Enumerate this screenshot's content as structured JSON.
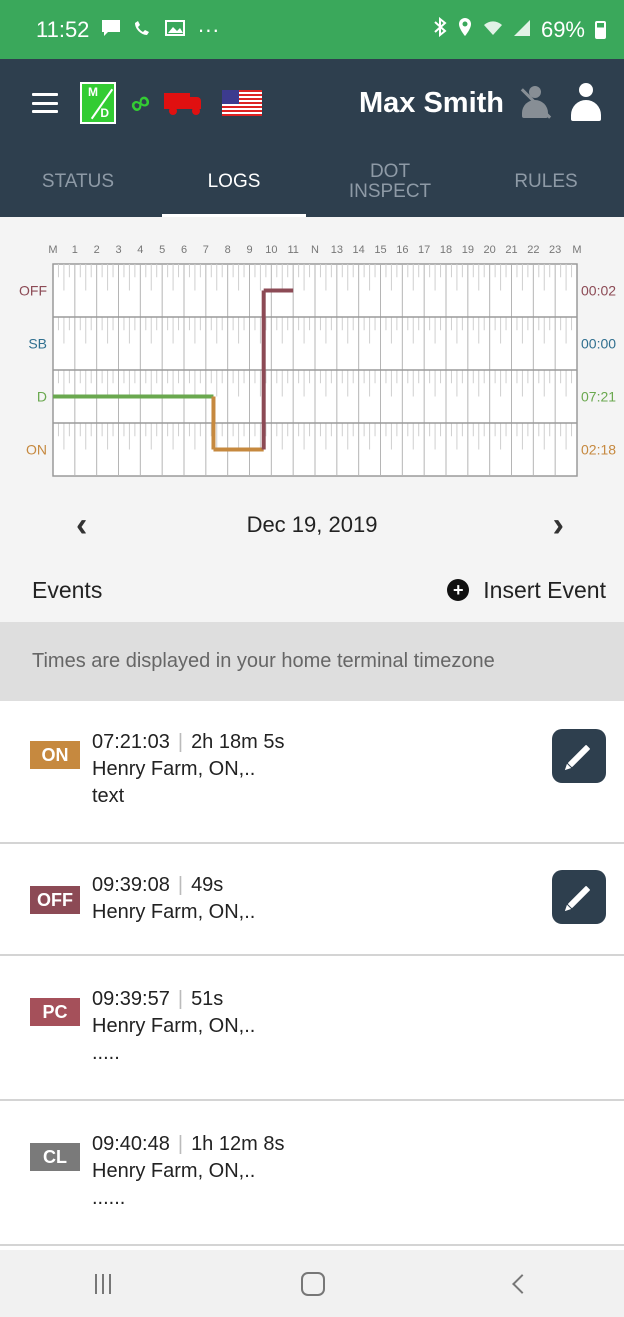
{
  "status_bar": {
    "time": "11:52",
    "overflow": "···",
    "battery": "69%",
    "icons": [
      "message-icon",
      "missed-call-icon",
      "image-icon",
      "bluetooth-icon",
      "location-icon",
      "wifi-icon",
      "signal-icon",
      "battery-icon"
    ]
  },
  "header": {
    "logo_m": "M",
    "logo_d": "D",
    "driver_name": "Max Smith",
    "colors": {
      "bar": "#2e3f4e",
      "logo": "#33cc33",
      "link": "#33cc33",
      "truck": "#e01010"
    }
  },
  "tabs": [
    {
      "label": "STATUS",
      "active": false
    },
    {
      "label": "LOGS",
      "active": true
    },
    {
      "label": "DOT\nINSPECT",
      "active": false
    },
    {
      "label": "RULES",
      "active": false
    }
  ],
  "log_chart": {
    "hour_labels": [
      "M",
      "1",
      "2",
      "3",
      "4",
      "5",
      "6",
      "7",
      "8",
      "9",
      "10",
      "11",
      "N",
      "13",
      "14",
      "15",
      "16",
      "17",
      "18",
      "19",
      "20",
      "21",
      "22",
      "23",
      "M"
    ],
    "rows": [
      {
        "label": "OFF",
        "total": "00:02",
        "color": "#8c4a55"
      },
      {
        "label": "SB",
        "total": "00:00",
        "color": "#2f6f8f"
      },
      {
        "label": "D",
        "total": "07:21",
        "color": "#6aa84f"
      },
      {
        "label": "ON",
        "total": "02:18",
        "color": "#c6893f"
      }
    ],
    "segments": [
      {
        "status": "D",
        "start_h": 0.0,
        "end_h": 7.35
      },
      {
        "status": "ON",
        "start_h": 7.35,
        "end_h": 9.65
      },
      {
        "status": "OFF",
        "start_h": 9.65,
        "end_h": 11.0
      }
    ]
  },
  "date_nav": {
    "date": "Dec 19, 2019",
    "prev": "‹",
    "next": "›"
  },
  "events_header": {
    "title": "Events",
    "insert_label": "Insert Event",
    "insert_icon": "+"
  },
  "tz_note": "Times are displayed in your home terminal timezone",
  "events": [
    {
      "status": "ON",
      "color": "#c6893f",
      "time": "07:21:03",
      "duration": "2h 18m 5s",
      "location": "Henry Farm, ON,..",
      "note": "text",
      "editable": true
    },
    {
      "status": "OFF",
      "color": "#8c4a55",
      "time": "09:39:08",
      "duration": "49s",
      "location": "Henry Farm, ON,..",
      "note": "",
      "editable": true
    },
    {
      "status": "PC",
      "color": "#a5505a",
      "time": "09:39:57",
      "duration": "51s",
      "location": "Henry Farm, ON,..",
      "note": ".....",
      "editable": false
    },
    {
      "status": "CL",
      "color": "#7a7a7a",
      "time": "09:40:48",
      "duration": "1h 12m 8s",
      "location": "Henry Farm, ON,..",
      "note": "......",
      "editable": false
    }
  ]
}
